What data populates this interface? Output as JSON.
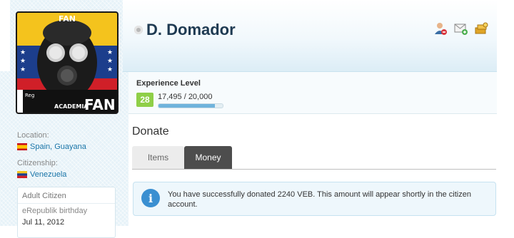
{
  "profile": {
    "name": "D. Domador",
    "avatar_text_top": "FAN",
    "avatar_text_bottom_small": "ACADEMIA",
    "avatar_text_bottom_big": "FAN",
    "avatar_text_reg": "Reg",
    "actions": [
      "add-friend-icon",
      "send-message-icon",
      "donate-icon"
    ]
  },
  "experience": {
    "label": "Experience Level",
    "level": "28",
    "value_text": "17,495 / 20,000",
    "progress": 0.875
  },
  "info": {
    "location_label": "Location:",
    "location_value": "Spain, Guayana",
    "citizenship_label": "Citizenship:",
    "citizenship_value": "Venezuela",
    "citizen_type": "Adult Citizen",
    "birthday_label": "eRepublik birthday",
    "birthday_value": "Jul 11, 2012"
  },
  "donate": {
    "title": "Donate",
    "tabs": [
      {
        "label": "Items",
        "active": false
      },
      {
        "label": "Money",
        "active": true
      }
    ],
    "notice_icon": "info-icon",
    "notice_text": "You have successfully donated 2240 VEB. This amount will appear shortly in the citizen account."
  },
  "colors": {
    "name": "#1e3a52",
    "level_badge": "#8fcf48",
    "active_tab": "#4d4d4d",
    "link": "#1a75a8",
    "info_icon": "#3a8fd1"
  }
}
